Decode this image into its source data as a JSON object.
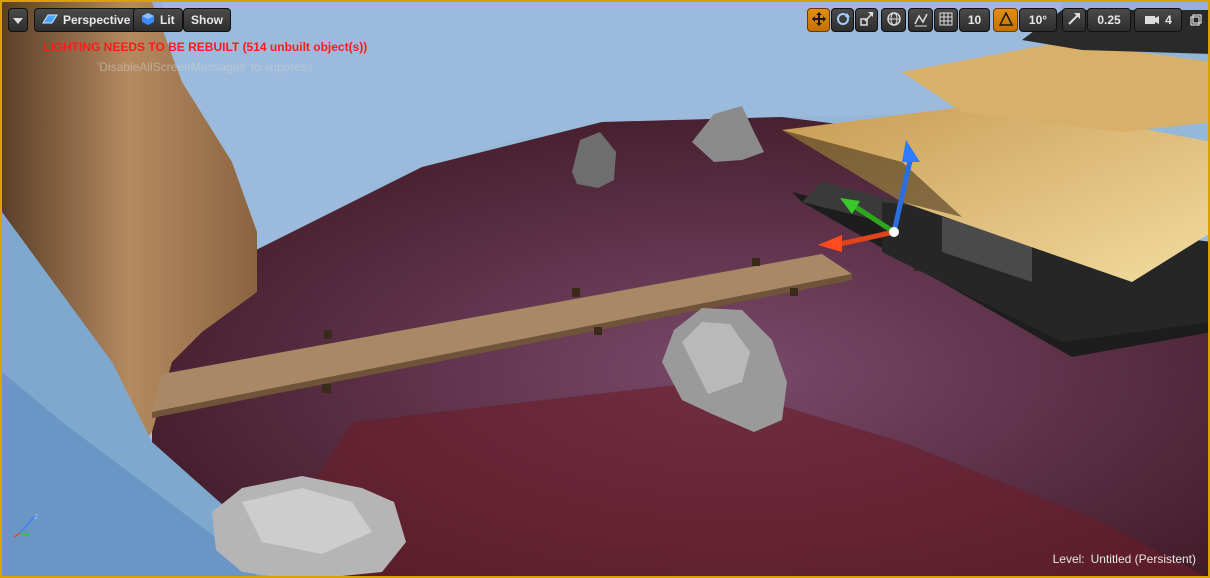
{
  "toolbar": {
    "perspective_label": "Perspective",
    "lit_label": "Lit",
    "show_label": "Show",
    "grid_snap_value": "10",
    "rotation_snap_value": "10°",
    "scale_snap_value": "0.25",
    "camera_speed_value": "4"
  },
  "messages": {
    "lighting_warning": "LIGHTING NEEDS TO BE REBUILT (514 unbuilt object(s))",
    "suppress_hint": "'DisableAllScreenMessages' to suppress"
  },
  "status": {
    "level_label": "Level:",
    "level_name": "Untitled (Persistent)"
  },
  "colors": {
    "accent": "#d9a200",
    "warning": "#ff1a1a",
    "active_toggle": "#e38f14"
  }
}
